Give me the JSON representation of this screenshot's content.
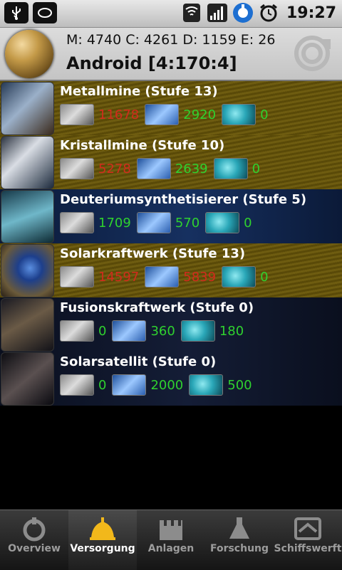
{
  "status_bar": {
    "time": "19:27",
    "icons": [
      "usb-icon",
      "notification-icon",
      "wifi-icon",
      "signal-icon",
      "power-control-icon",
      "alarm-icon"
    ]
  },
  "header": {
    "resources": "M: 4740 C: 4261 D: 1159 E: 26",
    "planet": "Android [4:170:4]",
    "refresh_icon": "refresh-icon"
  },
  "buildings": [
    {
      "name": "Metallmine (Stufe 13)",
      "metal": "11678",
      "metal_color": "red",
      "crystal": "2920",
      "crystal_color": "green",
      "deuterium": "0",
      "deuterium_color": "green",
      "bg": "gold"
    },
    {
      "name": "Kristallmine (Stufe 10)",
      "metal": "5278",
      "metal_color": "red",
      "crystal": "2639",
      "crystal_color": "green",
      "deuterium": "0",
      "deuterium_color": "green",
      "bg": "gold"
    },
    {
      "name": "Deuteriumsynthetisierer (Stufe 5)",
      "metal": "1709",
      "metal_color": "green",
      "crystal": "570",
      "crystal_color": "green",
      "deuterium": "0",
      "deuterium_color": "green",
      "bg": "space"
    },
    {
      "name": "Solarkraftwerk (Stufe 13)",
      "metal": "14597",
      "metal_color": "red",
      "crystal": "5839",
      "crystal_color": "red",
      "deuterium": "0",
      "deuterium_color": "green",
      "bg": "gold"
    },
    {
      "name": "Fusionskraftwerk (Stufe 0)",
      "metal": "0",
      "metal_color": "green",
      "crystal": "360",
      "crystal_color": "green",
      "deuterium": "180",
      "deuterium_color": "green",
      "bg": "dark"
    },
    {
      "name": "Solarsatellit (Stufe 0)",
      "metal": "0",
      "metal_color": "green",
      "crystal": "2000",
      "crystal_color": "green",
      "deuterium": "500",
      "deuterium_color": "green",
      "bg": "dark"
    }
  ],
  "tabs": [
    {
      "label": "Overview",
      "icon": "overview-icon",
      "active": false
    },
    {
      "label": "Versorgung",
      "icon": "supply-icon",
      "active": true
    },
    {
      "label": "Anlagen",
      "icon": "facilities-icon",
      "active": false
    },
    {
      "label": "Forschung",
      "icon": "research-icon",
      "active": false
    },
    {
      "label": "Schiffswerft",
      "icon": "shipyard-icon",
      "active": false
    }
  ],
  "colors": {
    "red": "#d12b1c",
    "green": "#2fd12f",
    "active_tab_icon": "#f2b81b"
  }
}
